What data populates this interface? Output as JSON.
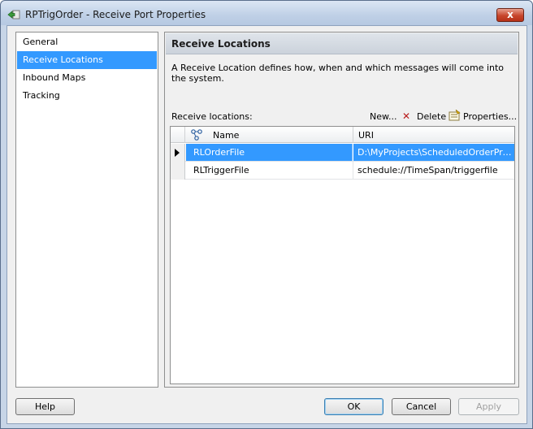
{
  "window": {
    "title": "RPTrigOrder - Receive Port Properties",
    "close_label": "x"
  },
  "nav": {
    "items": [
      {
        "label": "General",
        "selected": false
      },
      {
        "label": "Receive Locations",
        "selected": true
      },
      {
        "label": "Inbound Maps",
        "selected": false
      },
      {
        "label": "Tracking",
        "selected": false
      }
    ]
  },
  "panel": {
    "header": "Receive Locations",
    "description": "A Receive Location defines how, when and which messages will come into the system.",
    "list_label": "Receive locations:",
    "toolbar": {
      "new_label": "New...",
      "delete_label": "Delete",
      "properties_label": "Properties..."
    },
    "grid": {
      "columns": [
        "Name",
        "URI"
      ],
      "rows": [
        {
          "name": "RLOrderFile",
          "uri": "D:\\MyProjects\\ScheduledOrderProce...",
          "selected": true
        },
        {
          "name": "RLTriggerFile",
          "uri": "schedule://TimeSpan/triggerfile",
          "selected": false
        }
      ]
    }
  },
  "buttons": {
    "help": "Help",
    "ok": "OK",
    "cancel": "Cancel",
    "apply": "Apply"
  },
  "colors": {
    "selection": "#3399ff",
    "window_frame": "#c7d5e7",
    "close_button": "#c7462c"
  },
  "icons": {
    "title": "receive-port-icon",
    "delete": "red-x-icon",
    "properties": "properties-icon",
    "column": "receive-location-column-icon"
  }
}
